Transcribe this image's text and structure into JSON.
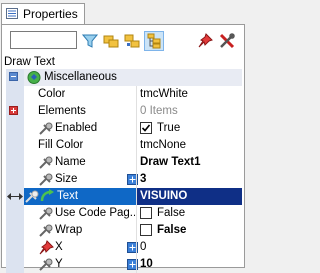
{
  "tab": {
    "label": "Properties"
  },
  "search": {
    "value": ""
  },
  "breadcrumb": "Draw Text",
  "category": {
    "label": "Miscellaneous"
  },
  "rows": [
    {
      "name": "Color",
      "value": "tmcWhite"
    },
    {
      "name": "Elements",
      "value": "0 Items"
    },
    {
      "name": "Enabled",
      "value": "True"
    },
    {
      "name": "Fill Color",
      "value": "tmcNone"
    },
    {
      "name": "Name",
      "value": "Draw Text1"
    },
    {
      "name": "Size",
      "value": "3"
    },
    {
      "name": "Text",
      "value": "VISUINO"
    },
    {
      "name": "Use Code Pag...",
      "value": "False"
    },
    {
      "name": "Wrap",
      "value": "False"
    },
    {
      "name": "X",
      "value": "0"
    },
    {
      "name": "Y",
      "value": "10"
    }
  ],
  "colors": {
    "selection": "#0f68c6",
    "value_selection": "#0f2f86",
    "gutter": "#dce3f0",
    "pin": "#3a7fd8"
  }
}
